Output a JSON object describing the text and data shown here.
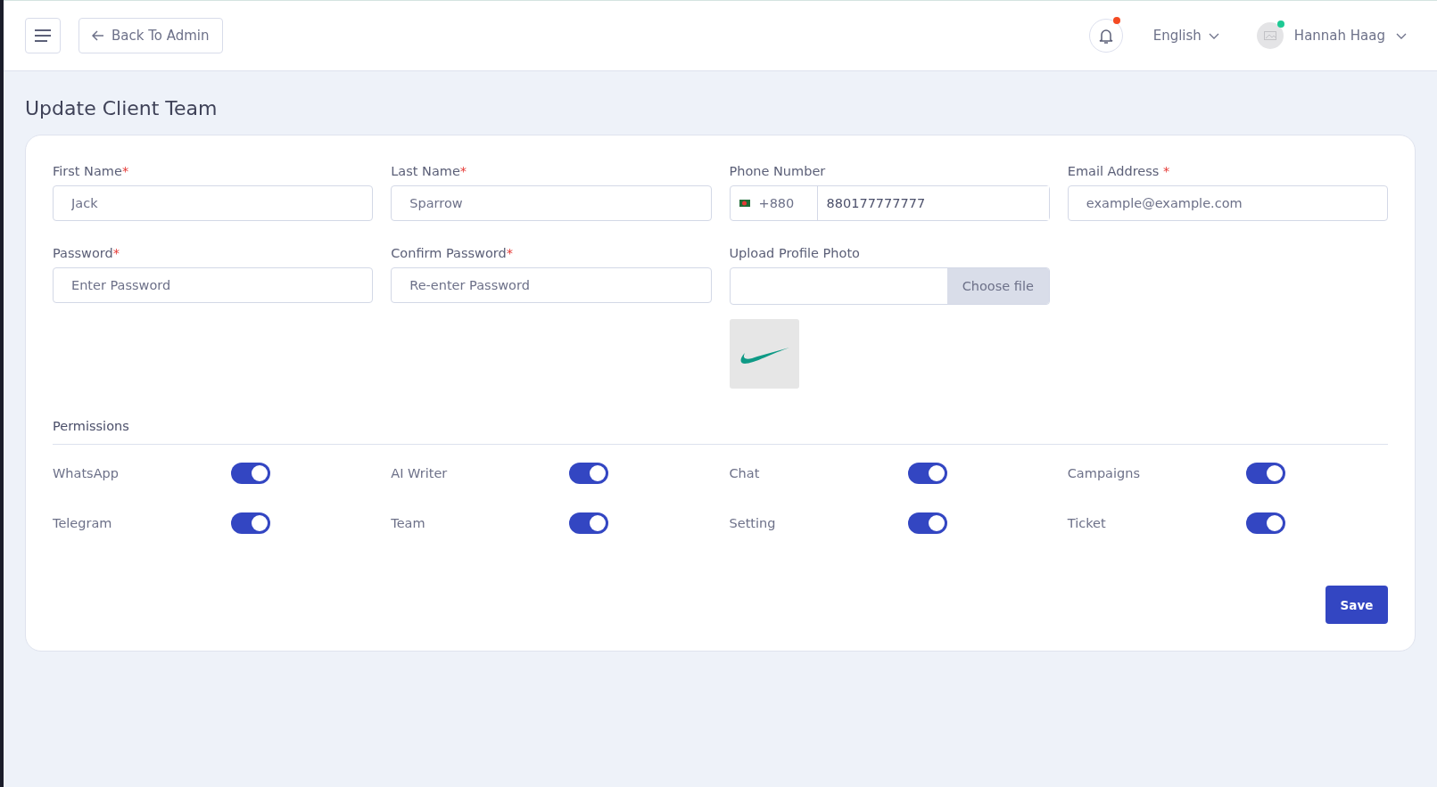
{
  "header": {
    "back_button": "Back To Admin",
    "language": "English",
    "user_name": "Hannah Haag",
    "notification_unread": true,
    "user_online": true
  },
  "page_title": "Update Client Team",
  "fields": [
    {
      "kind": "text",
      "label": "First Name",
      "required_mark": "*",
      "value": "Jack"
    },
    {
      "kind": "text",
      "label": "Last Name",
      "required_mark": "*",
      "value": "Sparrow"
    },
    {
      "kind": "phone",
      "label": "Phone Number",
      "code": "+880",
      "value": "880177777777"
    },
    {
      "kind": "text",
      "label": "Email Address",
      "required_mark": " *",
      "placeholder": "example@example.com"
    },
    {
      "kind": "text",
      "label": "Password",
      "required_mark": "*",
      "placeholder": "Enter Password"
    },
    {
      "kind": "text",
      "label": "Confirm Password",
      "required_mark": "*",
      "placeholder": "Re-enter Password"
    },
    {
      "kind": "file",
      "label": "Upload Profile Photo",
      "button": "Choose file"
    }
  ],
  "permissions_title": "Permissions",
  "permissions": [
    {
      "label": "WhatsApp",
      "on": true
    },
    {
      "label": "AI Writer",
      "on": true
    },
    {
      "label": "Chat",
      "on": true
    },
    {
      "label": "Campaigns",
      "on": true
    },
    {
      "label": "Telegram",
      "on": true
    },
    {
      "label": "Team",
      "on": true
    },
    {
      "label": "Setting",
      "on": true
    },
    {
      "label": "Ticket",
      "on": true
    }
  ],
  "save_button": "Save"
}
